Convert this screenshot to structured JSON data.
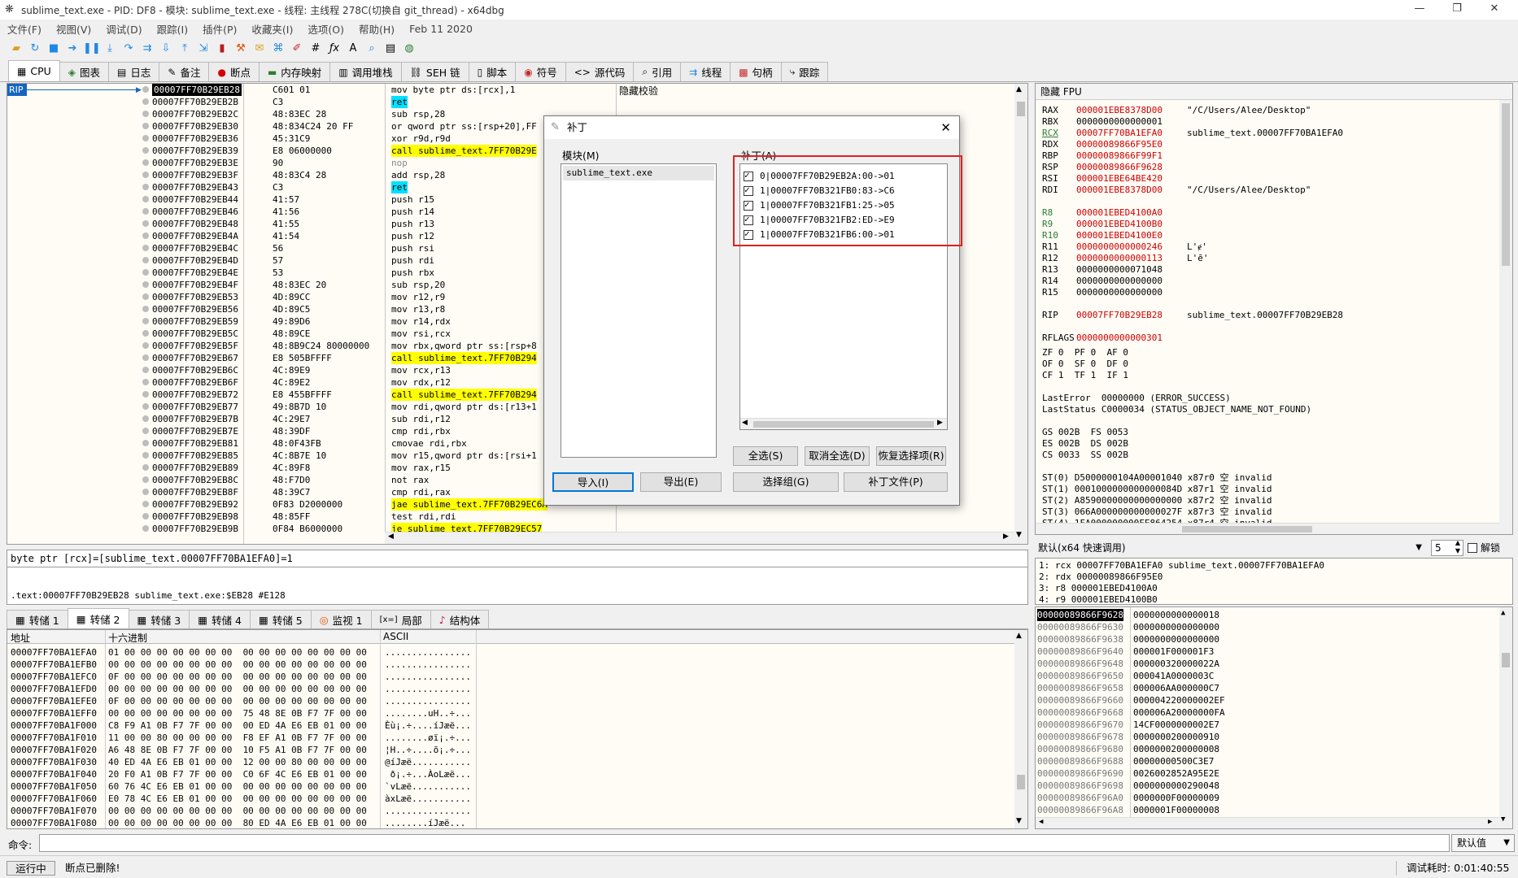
{
  "titlebar": {
    "title": "sublime_text.exe - PID: DF8 - 模块: sublime_text.exe - 线程: 主线程 278C(切换自 git_thread) - x64dbg",
    "min": "—",
    "max": "❐",
    "close": "✕"
  },
  "menu": [
    "文件(F)",
    "视图(V)",
    "调试(D)",
    "跟踪(I)",
    "插件(P)",
    "收藏夹(I)",
    "选项(O)",
    "帮助(H)",
    "Feb 11 2020"
  ],
  "tabs": [
    {
      "label": "CPU",
      "icon": "▦"
    },
    {
      "label": "图表",
      "icon": "◈"
    },
    {
      "label": "日志",
      "icon": "▤"
    },
    {
      "label": "备注",
      "icon": "✎"
    },
    {
      "label": "断点",
      "icon": "●"
    },
    {
      "label": "内存映射",
      "icon": "▬"
    },
    {
      "label": "调用堆栈",
      "icon": "▥"
    },
    {
      "label": "SEH 链",
      "icon": "⛓"
    },
    {
      "label": "脚本",
      "icon": "▯"
    },
    {
      "label": "符号",
      "icon": "◉"
    },
    {
      "label": "源代码",
      "icon": "<>"
    },
    {
      "label": "引用",
      "icon": "⌕"
    },
    {
      "label": "线程",
      "icon": "⇉"
    },
    {
      "label": "句柄",
      "icon": "▩"
    },
    {
      "label": "跟踪",
      "icon": "⤷"
    }
  ],
  "cpu": {
    "rip_label": "RIP",
    "header_right": "隐藏校验",
    "rows": [
      {
        "addr": "00007FF70B29EB28",
        "bytes": "C601 01",
        "asm": "mov byte ptr ds:[rcx],1",
        "style": "cur"
      },
      {
        "addr": "00007FF70B29EB2B",
        "bytes": "C3",
        "asm": "ret",
        "style": "ret"
      },
      {
        "addr": "00007FF70B29EB2C",
        "bytes": "48:83EC 28",
        "asm": "sub rsp,28",
        "style": ""
      },
      {
        "addr": "00007FF70B29EB30",
        "bytes": "48:834C24 20 FF",
        "asm": "or qword ptr ss:[rsp+20],FF",
        "style": ""
      },
      {
        "addr": "00007FF70B29EB36",
        "bytes": "45:31C9",
        "asm": "xor r9d,r9d",
        "style": ""
      },
      {
        "addr": "00007FF70B29EB39",
        "bytes": "E8 06000000",
        "asm": "call sublime_text.7FF70B29E",
        "style": "call"
      },
      {
        "addr": "00007FF70B29EB3E",
        "bytes": "90",
        "asm": "nop",
        "style": "nop"
      },
      {
        "addr": "00007FF70B29EB3F",
        "bytes": "48:83C4 28",
        "asm": "add rsp,28",
        "style": ""
      },
      {
        "addr": "00007FF70B29EB43",
        "bytes": "C3",
        "asm": "ret",
        "style": "ret"
      },
      {
        "addr": "00007FF70B29EB44",
        "bytes": "41:57",
        "asm": "push r15",
        "style": ""
      },
      {
        "addr": "00007FF70B29EB46",
        "bytes": "41:56",
        "asm": "push r14",
        "style": ""
      },
      {
        "addr": "00007FF70B29EB48",
        "bytes": "41:55",
        "asm": "push r13",
        "style": ""
      },
      {
        "addr": "00007FF70B29EB4A",
        "bytes": "41:54",
        "asm": "push r12",
        "style": ""
      },
      {
        "addr": "00007FF70B29EB4C",
        "bytes": "56",
        "asm": "push rsi",
        "style": ""
      },
      {
        "addr": "00007FF70B29EB4D",
        "bytes": "57",
        "asm": "push rdi",
        "style": ""
      },
      {
        "addr": "00007FF70B29EB4E",
        "bytes": "53",
        "asm": "push rbx",
        "style": ""
      },
      {
        "addr": "00007FF70B29EB4F",
        "bytes": "48:83EC 20",
        "asm": "sub rsp,20",
        "style": ""
      },
      {
        "addr": "00007FF70B29EB53",
        "bytes": "4D:89CC",
        "asm": "mov r12,r9",
        "style": ""
      },
      {
        "addr": "00007FF70B29EB56",
        "bytes": "4D:89C5",
        "asm": "mov r13,r8",
        "style": ""
      },
      {
        "addr": "00007FF70B29EB59",
        "bytes": "49:89D6",
        "asm": "mov r14,rdx",
        "style": ""
      },
      {
        "addr": "00007FF70B29EB5C",
        "bytes": "48:89CE",
        "asm": "mov rsi,rcx",
        "style": ""
      },
      {
        "addr": "00007FF70B29EB5F",
        "bytes": "48:8B9C24 80000000",
        "asm": "mov rbx,qword ptr ss:[rsp+8",
        "style": ""
      },
      {
        "addr": "00007FF70B29EB67",
        "bytes": "E8 505BFFFF",
        "asm": "call sublime_text.7FF70B294",
        "style": "call"
      },
      {
        "addr": "00007FF70B29EB6C",
        "bytes": "4C:89E9",
        "asm": "mov rcx,r13",
        "style": ""
      },
      {
        "addr": "00007FF70B29EB6F",
        "bytes": "4C:89E2",
        "asm": "mov rdx,r12",
        "style": ""
      },
      {
        "addr": "00007FF70B29EB72",
        "bytes": "E8 455BFFFF",
        "asm": "call sublime_text.7FF70B294",
        "style": "call"
      },
      {
        "addr": "00007FF70B29EB77",
        "bytes": "49:8B7D 10",
        "asm": "mov rdi,qword ptr ds:[r13+1",
        "style": ""
      },
      {
        "addr": "00007FF70B29EB7B",
        "bytes": "4C:29E7",
        "asm": "sub rdi,r12",
        "style": ""
      },
      {
        "addr": "00007FF70B29EB7E",
        "bytes": "48:39DF",
        "asm": "cmp rdi,rbx",
        "style": ""
      },
      {
        "addr": "00007FF70B29EB81",
        "bytes": "48:0F43FB",
        "asm": "cmovae rdi,rbx",
        "style": ""
      },
      {
        "addr": "00007FF70B29EB85",
        "bytes": "4C:8B7E 10",
        "asm": "mov r15,qword ptr ds:[rsi+1",
        "style": ""
      },
      {
        "addr": "00007FF70B29EB89",
        "bytes": "4C:89F8",
        "asm": "mov rax,r15",
        "style": ""
      },
      {
        "addr": "00007FF70B29EB8C",
        "bytes": "48:F7D0",
        "asm": "not rax",
        "style": ""
      },
      {
        "addr": "00007FF70B29EB8F",
        "bytes": "48:39C7",
        "asm": "cmp rdi,rax",
        "style": ""
      },
      {
        "addr": "00007FF70B29EB92",
        "bytes": "0F83 D2000000",
        "asm": "jae sublime_text.7FF70B29EC6A",
        "style": "jmp"
      },
      {
        "addr": "00007FF70B29EB98",
        "bytes": "48:85FF",
        "asm": "test rdi,rdi",
        "style": ""
      },
      {
        "addr": "00007FF70B29EB9B",
        "bytes": "0F84 B6000000",
        "asm": "je sublime_text.7FF70B29EC57",
        "style": "jmp"
      }
    ]
  },
  "info": {
    "line1": "byte ptr [rcx]=[sublime_text.00007FF70BA1EFA0]=1",
    "line2": ".text:00007FF70B29EB28 sublime_text.exe:$EB28 #E128"
  },
  "bottom_tabs": [
    {
      "label": "转储 1",
      "icon": "▦"
    },
    {
      "label": "转储 2",
      "icon": "▦"
    },
    {
      "label": "转储 3",
      "icon": "▦"
    },
    {
      "label": "转储 4",
      "icon": "▦"
    },
    {
      "label": "转储 5",
      "icon": "▦"
    },
    {
      "label": "监视 1",
      "icon": "◎"
    },
    {
      "label": "局部",
      "icon": "[x=]"
    },
    {
      "label": "结构体",
      "icon": "♪"
    }
  ],
  "dump": {
    "headers": [
      "地址",
      "十六进制",
      "ASCII"
    ],
    "rows": [
      {
        "addr": "00007FF70BA1EFA0",
        "hex": "01 00 00 00 00 00 00 00  00 00 00 00 00 00 00 00",
        "ascii": "................"
      },
      {
        "addr": "00007FF70BA1EFB0",
        "hex": "00 00 00 00 00 00 00 00  00 00 00 00 00 00 00 00",
        "ascii": "................"
      },
      {
        "addr": "00007FF70BA1EFC0",
        "hex": "0F 00 00 00 00 00 00 00  00 00 00 00 00 00 00 00",
        "ascii": "................"
      },
      {
        "addr": "00007FF70BA1EFD0",
        "hex": "00 00 00 00 00 00 00 00  00 00 00 00 00 00 00 00",
        "ascii": "................"
      },
      {
        "addr": "00007FF70BA1EFE0",
        "hex": "0F 00 00 00 00 00 00 00  00 00 00 00 00 00 00 00",
        "ascii": "................"
      },
      {
        "addr": "00007FF70BA1EFF0",
        "hex": "00 00 00 00 00 00 00 00  75 48 8E 0B F7 7F 00 00",
        "ascii": "........uH..÷..."
      },
      {
        "addr": "00007FF70BA1F000",
        "hex": "C8 F9 A1 0B F7 7F 00 00  00 ED 4A E6 EB 01 00 00",
        "ascii": "Èù¡.÷....íJæë..."
      },
      {
        "addr": "00007FF70BA1F010",
        "hex": "11 00 00 80 00 00 00 00  F8 EF A1 0B F7 7F 00 00",
        "ascii": "........øï¡.÷..."
      },
      {
        "addr": "00007FF70BA1F020",
        "hex": "A6 48 8E 0B F7 7F 00 00  10 F5 A1 0B F7 7F 00 00",
        "ascii": "¦H..÷....õ¡.÷..."
      },
      {
        "addr": "00007FF70BA1F030",
        "hex": "40 ED 4A E6 EB 01 00 00  12 00 00 80 00 00 00 00",
        "ascii": "@íJæë..........."
      },
      {
        "addr": "00007FF70BA1F040",
        "hex": "20 F0 A1 0B F7 7F 00 00  C0 6F 4C E6 EB 01 00 00",
        "ascii": " ð¡.÷...ÀoLæë..."
      },
      {
        "addr": "00007FF70BA1F050",
        "hex": "60 76 4C E6 EB 01 00 00  00 00 00 00 00 00 00 00",
        "ascii": "`vLæë..........."
      },
      {
        "addr": "00007FF70BA1F060",
        "hex": "E0 78 4C E6 EB 01 00 00  00 00 00 00 00 00 00 00",
        "ascii": "àxLæë..........."
      },
      {
        "addr": "00007FF70BA1F070",
        "hex": "00 00 00 00 00 00 00 00  00 00 00 00 00 00 00 00",
        "ascii": "................"
      },
      {
        "addr": "00007FF70BA1F080",
        "hex": "00 00 00 00 00 00 00 00  80 ED 4A E6 EB 01 00 00",
        "ascii": "........íJæë..."
      }
    ]
  },
  "regs": {
    "header": "隐藏 FPU",
    "lines": [
      {
        "name": "RAX",
        "val": "000001EBE8378D00",
        "cmt": "\"/C/Users/Alee/Desktop\"",
        "hl": false
      },
      {
        "name": "RBX",
        "val": "0000000000000001",
        "cmt": "",
        "hl": false
      },
      {
        "name": "RCX",
        "val": "00007FF70BA1EFA0",
        "cmt": "sublime_text.00007FF70BA1EFA0",
        "hl": true
      },
      {
        "name": "RDX",
        "val": "00000089866F95E0",
        "cmt": "",
        "hl": false
      },
      {
        "name": "RBP",
        "val": "00000089866F99F1",
        "cmt": "",
        "hl": false
      },
      {
        "name": "RSP",
        "val": "00000089866F9628",
        "cmt": "",
        "hl": false
      },
      {
        "name": "RSI",
        "val": "000001EBE64BE420",
        "cmt": "",
        "hl": false
      },
      {
        "name": "RDI",
        "val": "000001EBE8378D00",
        "cmt": "\"/C/Users/Alee/Desktop\"",
        "hl": false
      },
      {
        "name": "",
        "val": "",
        "cmt": "",
        "hl": false
      },
      {
        "name": "R8",
        "val": "000001EBED4100A0",
        "cmt": "",
        "hl": false
      },
      {
        "name": "R9",
        "val": "000001EBED4100B0",
        "cmt": "",
        "hl": false
      },
      {
        "name": "R10",
        "val": "000001EBED4100E0",
        "cmt": "",
        "hl": false
      },
      {
        "name": "R11",
        "val": "0000000000000246",
        "cmt": "L'ɇ'",
        "hl": false
      },
      {
        "name": "R12",
        "val": "0000000000000113",
        "cmt": "L'ē'",
        "hl": false
      },
      {
        "name": "R13",
        "val": "0000000000071048",
        "cmt": "",
        "hl": false
      },
      {
        "name": "R14",
        "val": "0000000000000000",
        "cmt": "",
        "hl": false
      },
      {
        "name": "R15",
        "val": "0000000000000000",
        "cmt": "",
        "hl": false
      },
      {
        "name": "",
        "val": "",
        "cmt": "",
        "hl": false
      },
      {
        "name": "RIP",
        "val": "00007FF70B29EB28",
        "cmt": "sublime_text.00007FF70B29EB28",
        "hl": false
      },
      {
        "name": "",
        "val": "",
        "cmt": "",
        "hl": false
      },
      {
        "name": "RFLAGS",
        "val": "0000000000000301",
        "cmt": "",
        "hl": false
      }
    ],
    "flags": [
      "ZF 0  PF 0  AF 0",
      "OF 0  SF 0  DF 0",
      "CF 1  TF 1  IF 1"
    ],
    "last_error": "LastError  00000000 (ERROR_SUCCESS)",
    "last_status": "LastStatus C0000034 (STATUS_OBJECT_NAME_NOT_FOUND)",
    "segs": [
      "GS 002B  FS 0053",
      "ES 002B  DS 002B",
      "CS 0033  SS 002B"
    ],
    "fpu": [
      "ST(0) D5000000104A00001040 x87r0 空 invalid",
      "ST(1) 0001000000000000084D x87r1 空 invalid",
      "ST(2) A8590000000000000000 x87r2 空 invalid",
      "ST(3) 066A000000000000027F x87r3 空 invalid",
      "ST(4) 1FA000000000FE864254 x87r4 空 invalid"
    ]
  },
  "callconv": {
    "select": "默认(x64 快速调用)",
    "count": "5",
    "unlock": "解锁"
  },
  "calllines": [
    "1: rcx 00007FF70BA1EFA0 sublime_text.00007FF70BA1EFA0",
    "2: rdx 00000089866F95E0",
    "3: r8 000001EBED4100A0",
    "4: r9 000001EBED4100B0"
  ],
  "stack": [
    {
      "addr": "00000089866F9628",
      "val": "0000000000000018"
    },
    {
      "addr": "00000089866F9630",
      "val": "0000000000000000"
    },
    {
      "addr": "00000089866F9638",
      "val": "0000000000000000"
    },
    {
      "addr": "00000089866F9640",
      "val": "000001F000001F3"
    },
    {
      "addr": "00000089866F9648",
      "val": "000000320000022A"
    },
    {
      "addr": "00000089866F9650",
      "val": "000041A0000003C"
    },
    {
      "addr": "00000089866F9658",
      "val": "000006AA000000C7"
    },
    {
      "addr": "00000089866F9660",
      "val": "000004220000002EF"
    },
    {
      "addr": "00000089866F9668",
      "val": "000006A20000000FA"
    },
    {
      "addr": "00000089866F9670",
      "val": "14CF0000000002E7"
    },
    {
      "addr": "00000089866F9678",
      "val": "0000000200000910"
    },
    {
      "addr": "00000089866F9680",
      "val": "0000000200000008"
    },
    {
      "addr": "00000089866F9688",
      "val": "00000000500C3E7"
    },
    {
      "addr": "00000089866F9690",
      "val": "0026002852A95E2E"
    },
    {
      "addr": "00000089866F9698",
      "val": "0000000000290048"
    },
    {
      "addr": "00000089866F96A0",
      "val": "0000000F00000009"
    },
    {
      "addr": "00000089866F96A8",
      "val": "0000001F00000008"
    }
  ],
  "cmd": {
    "label": "命令:",
    "dropdown": "默认值"
  },
  "status": {
    "run": "运行中",
    "msg": "断点已删除!",
    "timer": "调试耗时:  0:01:40:55"
  },
  "dialog": {
    "title": "补丁",
    "close": "✕",
    "module_label": "模块(M)",
    "patch_label": "补丁(A)",
    "modules": [
      "sublime_text.exe"
    ],
    "patches": [
      "0|00007FF70B29EB2A:00->01",
      "1|00007FF70B321FB0:83->C6",
      "1|00007FF70B321FB1:25->05",
      "1|00007FF70B321FB2:ED->E9",
      "1|00007FF70B321FB6:00->01"
    ],
    "btn_import": "导入(I)",
    "btn_export": "导出(E)",
    "btn_selall": "全选(S)",
    "btn_deselall": "取消全选(D)",
    "btn_restore": "恢复选择项(R)",
    "btn_selgroup": "选择组(G)",
    "btn_patchfile": "补丁文件(P)"
  },
  "colors": {
    "accent": "#1565c0",
    "call": "#00e0ff",
    "jump": "#ffff00",
    "reg_changed": "#d00000",
    "highlight_box": "#e02020"
  }
}
